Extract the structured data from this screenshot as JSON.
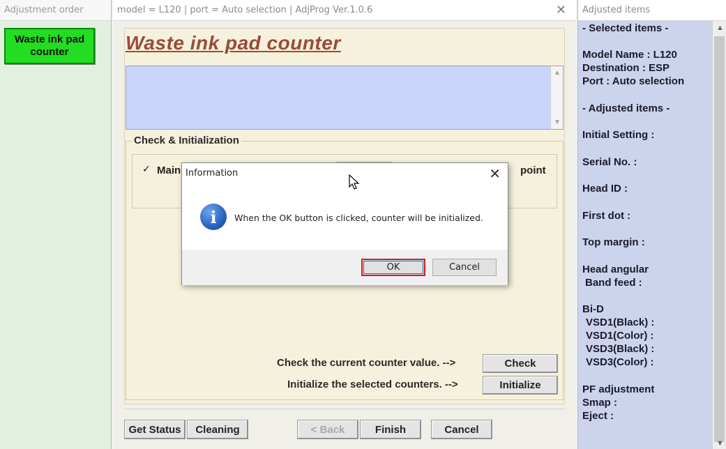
{
  "left_window": {
    "title": "Adjustment order",
    "item": "Waste ink pad counter"
  },
  "main_window": {
    "title": "model = L120 | port = Auto selection | AdjProg Ver.1.0.6",
    "heading": "Waste ink pad counter",
    "group_title": "Check & Initialization",
    "checkbox_mark": "✓",
    "checkbox_label": "Main",
    "checkbox_label_tail": "point",
    "check_text": "Check the current counter value. -->",
    "check_button": "Check",
    "init_text": "Initialize the selected counters. -->",
    "init_button": "Initialize",
    "bottom_buttons": {
      "get_status": "Get Status",
      "cleaning": "Cleaning",
      "back": "< Back",
      "finish": "Finish",
      "cancel": "Cancel"
    }
  },
  "right_window": {
    "title": "Adjusted items",
    "lines": [
      "- Selected items -",
      "Model Name : L120",
      "Destination : ESP",
      "Port : Auto selection",
      "- Adjusted items -",
      "Initial Setting :",
      "Serial No. :",
      "Head ID :",
      "First dot :",
      "Top margin :",
      "Head angular",
      " Band feed :",
      "Bi-D",
      " VSD1(Black) :",
      " VSD1(Color) :",
      " VSD3(Black) :",
      " VSD3(Color) :",
      "PF adjustment",
      "Smap :",
      "Eject :"
    ]
  },
  "dialog": {
    "title": "Information",
    "message": "When the OK button is clicked, counter will be initialized.",
    "ok": "OK",
    "cancel": "Cancel"
  }
}
